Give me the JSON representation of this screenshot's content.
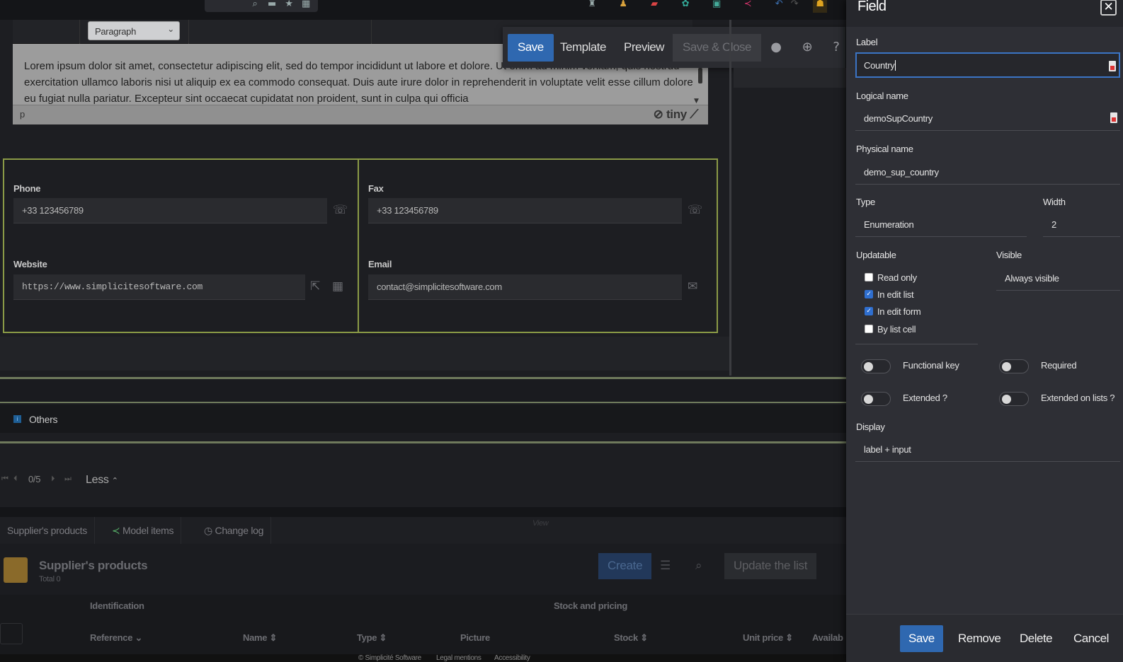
{
  "editor": {
    "format_select": "Paragraph",
    "content": "Lorem ipsum dolor sit amet, consectetur adipiscing elit, sed do tempor incididunt ut labore et dolore. Ut enim ad minim veniam, quis nostrud exercitation ullamco laboris nisi ut aliquip ex ea commodo consequat. Duis aute irure dolor in reprehenderit in voluptate velit esse cillum dolore eu fugiat nulla pariatur. Excepteur sint occaecat cupidatat non proident, sunt in culpa qui officia",
    "status_path": "p",
    "brand": "tiny"
  },
  "float_toolbar": {
    "save": "Save",
    "template": "Template",
    "preview": "Preview",
    "save_close": "Save & Close"
  },
  "contact": {
    "phone_label": "Phone",
    "phone_value": "+33 123456789",
    "fax_label": "Fax",
    "fax_value": "+33 123456789",
    "website_label": "Website",
    "website_value": "https://www.simplicitesoftware.com",
    "email_label": "Email",
    "email_value": "contact@simplicitesoftware.com"
  },
  "others": {
    "label": "Others"
  },
  "pager": {
    "count": "0/5",
    "less": "Less"
  },
  "tabs": [
    "Supplier's products",
    "Model items",
    "Change log"
  ],
  "view_label": "View",
  "products": {
    "title": "Supplier's products",
    "total": "Total 0",
    "create": "Create",
    "update": "Update the list",
    "group_identification": "Identification",
    "group_stock": "Stock and pricing",
    "columns": [
      "Reference",
      "Name",
      "Type",
      "Picture",
      "Stock",
      "Unit price",
      "Availab"
    ]
  },
  "footer": [
    "© Simplicité Software",
    "Legal mentions",
    "Accessibility"
  ],
  "panel": {
    "title": "Field",
    "label_label": "Label",
    "label_value": "Country",
    "logical_label": "Logical name",
    "logical_value": "demoSupCountry",
    "physical_label": "Physical name",
    "physical_value": "demo_sup_country",
    "type_label": "Type",
    "type_value": "Enumeration",
    "width_label": "Width",
    "width_value": "2",
    "updatable_label": "Updatable",
    "visible_label": "Visible",
    "visible_value": "Always visible",
    "checkboxes": [
      {
        "label": "Read only",
        "checked": false
      },
      {
        "label": "In edit list",
        "checked": true
      },
      {
        "label": "In edit form",
        "checked": true
      },
      {
        "label": "By list cell",
        "checked": false
      }
    ],
    "toggles": [
      "Functional key",
      "Required",
      "Extended ?",
      "Extended on lists ?"
    ],
    "display_label": "Display",
    "display_value": "label + input",
    "save": "Save",
    "remove": "Remove",
    "delete": "Delete",
    "cancel": "Cancel"
  },
  "colors": {
    "accent": "#2f68b0",
    "section_border": "#8a9a46"
  }
}
